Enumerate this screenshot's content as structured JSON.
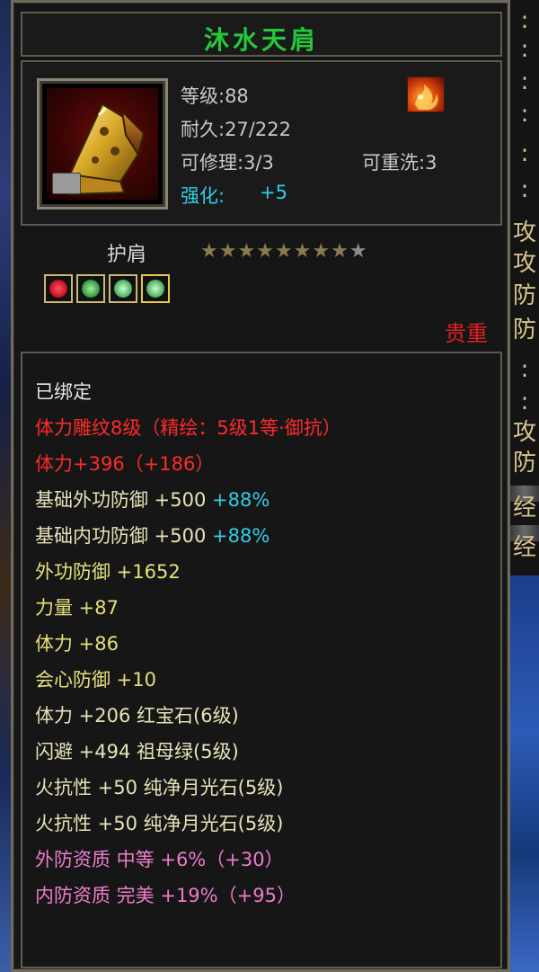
{
  "item": {
    "name": "沐水天肩",
    "level": "等级:88",
    "durability": "耐久:27/222",
    "repairable": "可修理:3/3",
    "rewashable": "可重洗:3",
    "enhance_label": "强化:",
    "enhance_value": "+5",
    "slot": "护肩",
    "rarity": "贵重",
    "stars_total": 9,
    "stars_filled": 8
  },
  "gems": [
    {
      "name": "ruby-gem",
      "color": "#c8182a"
    },
    {
      "name": "emerald-gem",
      "color": "#3ea04a"
    },
    {
      "name": "jade-gem",
      "color": "#5ab86a"
    },
    {
      "name": "jade-gem",
      "color": "#5ab86a"
    }
  ],
  "attributes": {
    "bound": "已绑定",
    "engraving": "体力雕纹8级（精绘：5级1等·御抗）",
    "engraving_stat": "体力+396（+186）",
    "base_ext_def": "基础外功防御  +500",
    "base_ext_def_pct": "+88%",
    "base_int_def": "基础内功防御  +500",
    "base_int_def_pct": "+88%",
    "ext_def": "外功防御  +1652",
    "strength": "力量  +87",
    "stamina": "体力  +86",
    "crit_def": "会心防御  +10",
    "gem_stamina": "体力  +206  红宝石(6级)",
    "gem_dodge": "闪避  +494  祖母绿(5级)",
    "gem_fire1": "火抗性  +50  纯净月光石(5级)",
    "gem_fire2": "火抗性  +50  纯净月光石(5级)",
    "quality_ext": "外防资质   中等  +6%（+30）",
    "quality_int": "内防资质   完美  +19%（+95）"
  },
  "background": {
    "right_column": [
      ":",
      ":",
      ":",
      ":",
      ":",
      ":",
      "攻",
      "攻",
      "防",
      "防",
      ":",
      ":",
      "攻",
      "防",
      "经",
      "经"
    ]
  }
}
